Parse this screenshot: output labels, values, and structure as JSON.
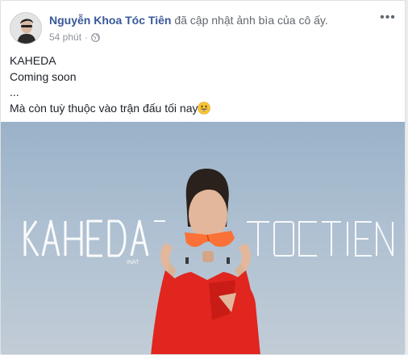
{
  "post": {
    "author": "Nguyễn Khoa Tóc Tiên",
    "action": "đã cập nhật ảnh bìa của cô ấy.",
    "time": "54 phút",
    "separator": "·",
    "privacy_icon": "globe-icon",
    "more_icon": "ellipsis-icon",
    "lines": [
      "KAHEDA",
      "Coming soon",
      "...",
      "Mà còn tuỳ thuộc vào trận đấu tối nay"
    ],
    "emoji": "grinning-face-emoji"
  },
  "cover_photo": {
    "logo_left": "KAHEDA",
    "logo_left_sub": "INAT",
    "logo_right": "TOCTIEN"
  },
  "colors": {
    "author_link": "#385898",
    "meta_gray": "#90949c",
    "dress_red": "#e0261f",
    "glasses_orange": "#ff6a2a"
  }
}
